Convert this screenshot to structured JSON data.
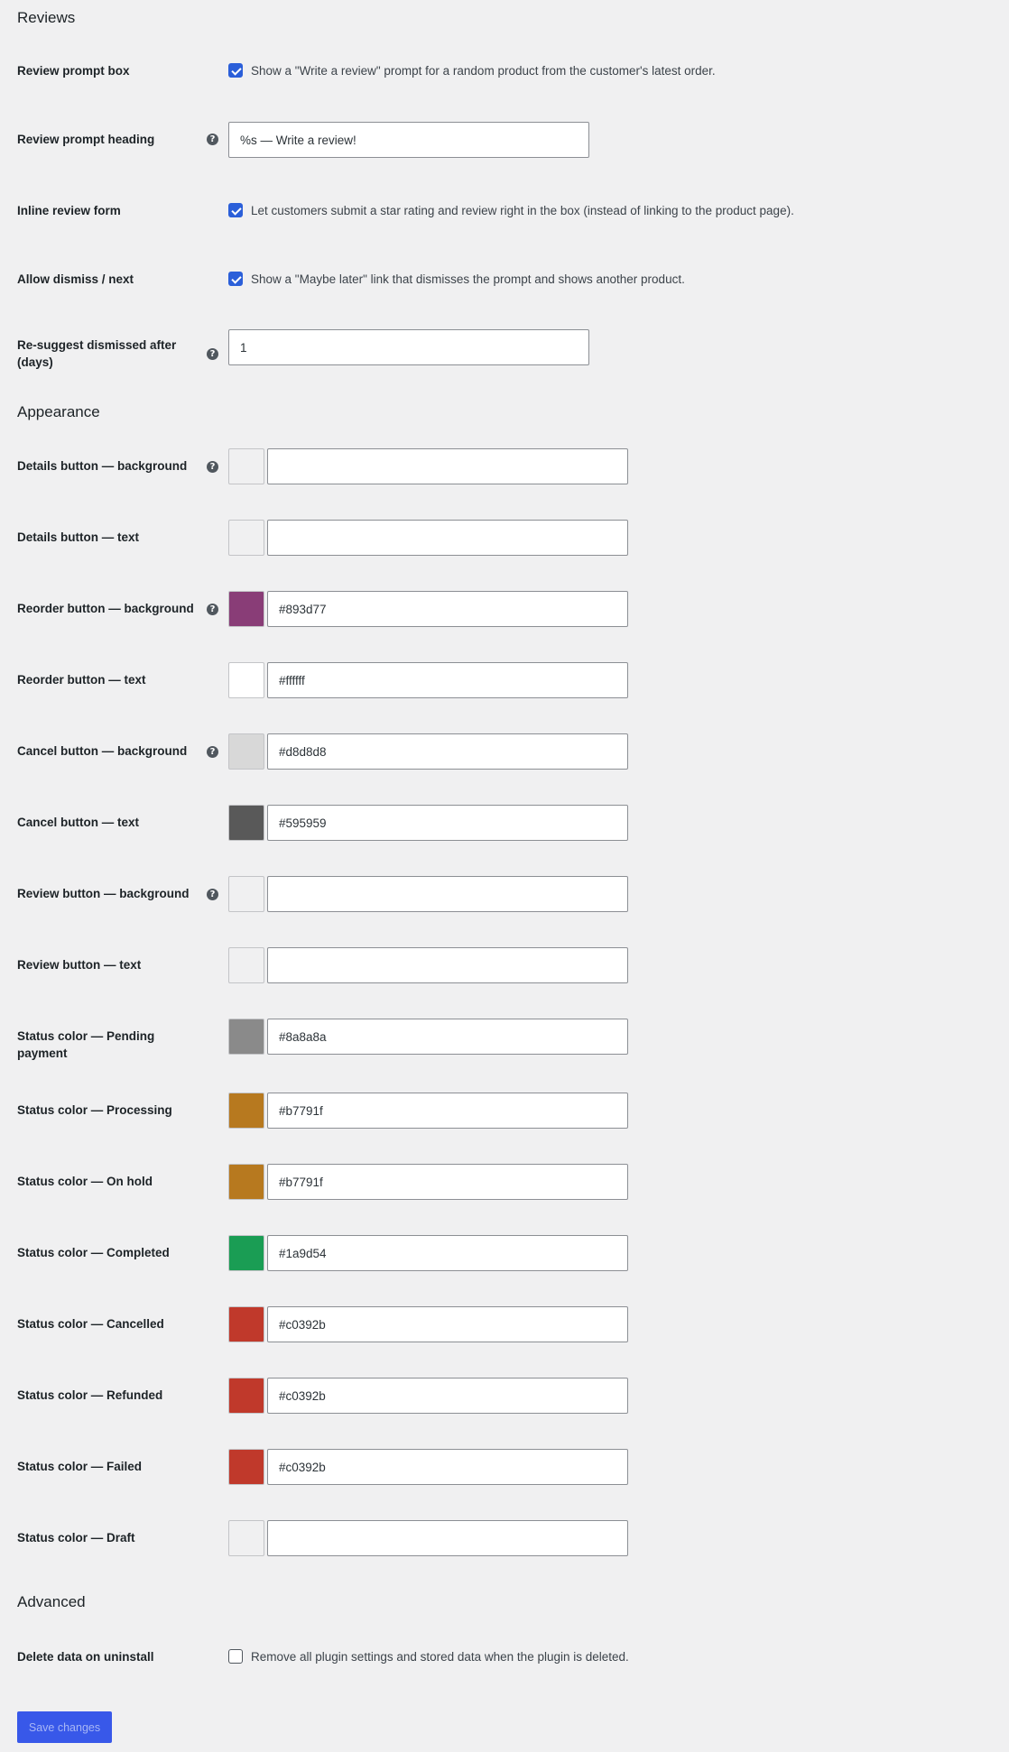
{
  "sections": {
    "reviews": "Reviews",
    "appearance": "Appearance",
    "advanced": "Advanced"
  },
  "reviews": {
    "prompt_box": {
      "label": "Review prompt box",
      "checked": true,
      "description": "Show a \"Write a review\" prompt for a random product from the customer's latest order."
    },
    "prompt_heading": {
      "label": "Review prompt heading",
      "value": "%s — Write a review!"
    },
    "inline_form": {
      "label": "Inline review form",
      "checked": true,
      "description": "Let customers submit a star rating and review right in the box (instead of linking to the product page)."
    },
    "allow_dismiss": {
      "label": "Allow dismiss / next",
      "checked": true,
      "description": "Show a \"Maybe later\" link that dismisses the prompt and shows another product."
    },
    "resuggest": {
      "label": "Re-suggest dismissed after (days)",
      "value": "1"
    }
  },
  "appearance": {
    "details_bg": {
      "label": "Details button — background",
      "value": "",
      "swatch": "#f0f0f1"
    },
    "details_text": {
      "label": "Details button — text",
      "value": "",
      "swatch": "#f0f0f1"
    },
    "reorder_bg": {
      "label": "Reorder button — background",
      "value": "#893d77",
      "swatch": "#893d77"
    },
    "reorder_text": {
      "label": "Reorder button — text",
      "value": "#ffffff",
      "swatch": "#ffffff"
    },
    "cancel_bg": {
      "label": "Cancel button — background",
      "value": "#d8d8d8",
      "swatch": "#d8d8d8"
    },
    "cancel_text": {
      "label": "Cancel button — text",
      "value": "#595959",
      "swatch": "#595959"
    },
    "review_bg": {
      "label": "Review button — background",
      "value": "",
      "swatch": "#f0f0f1"
    },
    "review_text": {
      "label": "Review button — text",
      "value": "",
      "swatch": "#f0f0f1"
    },
    "status_pending": {
      "label": "Status color — Pending payment",
      "value": "#8a8a8a",
      "swatch": "#8a8a8a"
    },
    "status_processing": {
      "label": "Status color — Processing",
      "value": "#b7791f",
      "swatch": "#b7791f"
    },
    "status_on_hold": {
      "label": "Status color — On hold",
      "value": "#b7791f",
      "swatch": "#b7791f"
    },
    "status_completed": {
      "label": "Status color — Completed",
      "value": "#1a9d54",
      "swatch": "#1a9d54"
    },
    "status_cancelled": {
      "label": "Status color — Cancelled",
      "value": "#c0392b",
      "swatch": "#c0392b"
    },
    "status_refunded": {
      "label": "Status color — Refunded",
      "value": "#c0392b",
      "swatch": "#c0392b"
    },
    "status_failed": {
      "label": "Status color — Failed",
      "value": "#c0392b",
      "swatch": "#c0392b"
    },
    "status_draft": {
      "label": "Status color — Draft",
      "value": "",
      "swatch": "#f0f0f1"
    }
  },
  "advanced": {
    "delete_data": {
      "label": "Delete data on uninstall",
      "checked": false,
      "description": "Remove all plugin settings and stored data when the plugin is deleted."
    }
  },
  "help_icon_glyph": "?",
  "save_label": "Save changes"
}
